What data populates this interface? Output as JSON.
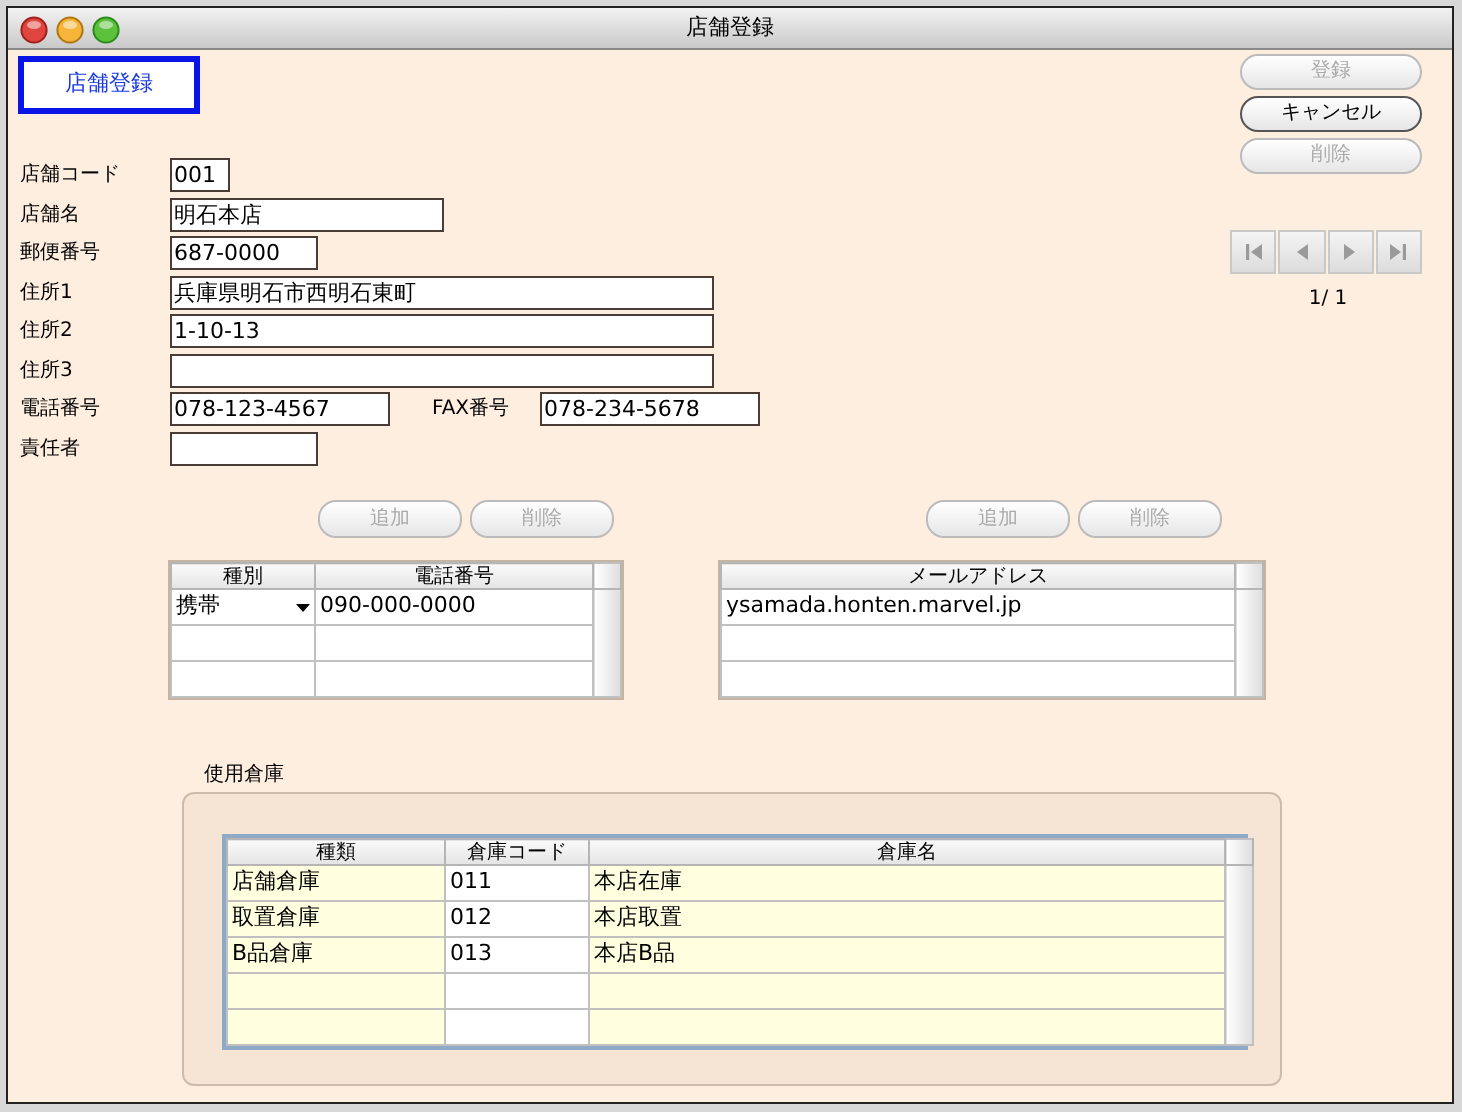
{
  "window": {
    "title": "店舗登録"
  },
  "heading": "店舗登録",
  "buttons": [
    {
      "label": "登録",
      "disabled": true
    },
    {
      "label": "キャンセル",
      "disabled": false
    },
    {
      "label": "削除",
      "disabled": true
    }
  ],
  "navigation": {
    "buttons": [
      {
        "kind": "first",
        "disabled": true
      },
      {
        "kind": "previous",
        "disabled": true
      },
      {
        "kind": "next",
        "disabled": true
      },
      {
        "kind": "last",
        "disabled": true
      }
    ],
    "page": "1/ 1"
  },
  "fields": [
    {
      "label": "店舗コード",
      "value": "001",
      "inline": false
    },
    {
      "label": "店舗名",
      "value": "明石本店",
      "inline": false
    },
    {
      "label": "郵便番号",
      "value": "687-0000",
      "inline": false
    },
    {
      "label": "住所1",
      "value": "兵庫県明石市西明石東町",
      "inline": false
    },
    {
      "label": "住所2",
      "value": "1-10-13",
      "inline": false
    },
    {
      "label": "住所3",
      "inline": false
    },
    {
      "label": "電話番号",
      "value": "078-123-4567",
      "inline": false
    },
    {
      "label": "FAX番号",
      "value": "078-234-5678",
      "inline": true
    },
    {
      "label": "責任者",
      "inline": false
    }
  ],
  "phones": {
    "buttons": [
      {
        "label": "追加",
        "disabled": true
      },
      {
        "label": "削除",
        "disabled": true
      }
    ],
    "columns": [
      {
        "label": "種別",
        "kind": "dropdown"
      },
      {
        "label": "電話番号"
      }
    ],
    "rows": [
      {
        "cells": [
          "携帯",
          "090-000-0000"
        ]
      }
    ]
  },
  "emails": {
    "buttons": [
      {
        "label": "追加",
        "disabled": true
      },
      {
        "label": "削除",
        "disabled": true
      }
    ],
    "columns": [
      {
        "label": "メールアドレス"
      }
    ],
    "rows": [
      {
        "cells": [
          "ysamada.honten.marvel.jp"
        ]
      }
    ]
  },
  "warehouses": {
    "title": "使用倉庫",
    "columns": [
      {
        "label": "種類"
      },
      {
        "label": "倉庫コード"
      },
      {
        "label": "倉庫名"
      }
    ],
    "rows": [
      {
        "cells": [
          "店舗倉庫",
          "011",
          "本店在庫"
        ]
      },
      {
        "cells": [
          "取置倉庫",
          "012",
          "本店取置"
        ]
      },
      {
        "cells": [
          "B品倉庫",
          "013",
          "本店B品"
        ]
      }
    ]
  }
}
